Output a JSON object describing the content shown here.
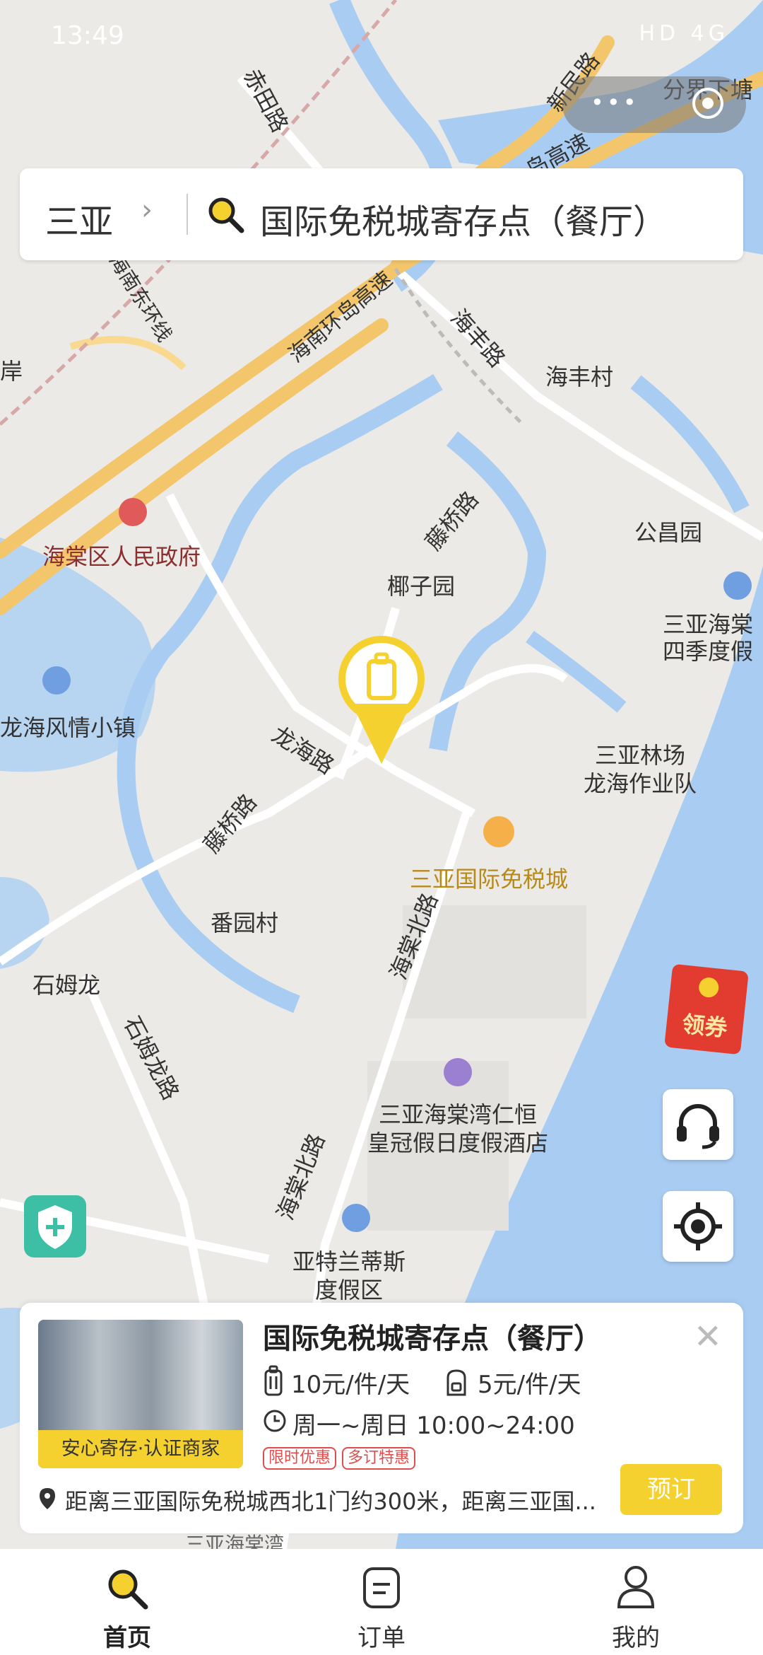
{
  "status_bar": {
    "time": "13:49",
    "indicators": "HD 4G"
  },
  "search": {
    "city": "三亚",
    "query": "国际免税城寄存点（餐厅）"
  },
  "map": {
    "labels": [
      {
        "name": "label-chitian-road",
        "text": "赤田路"
      },
      {
        "name": "label-xinmin-road",
        "text": "新民路"
      },
      {
        "name": "label-fenjiexiatang",
        "text": "分界下塘"
      },
      {
        "name": "label-expressway-top",
        "text": "岛高速"
      },
      {
        "name": "label-hainan-east-ring",
        "text": "海南东环线"
      },
      {
        "name": "label-hainan-ring-expressway",
        "text": "海南环岛高速"
      },
      {
        "name": "label-haifeng-road",
        "text": "海丰路"
      },
      {
        "name": "label-haifeng-village",
        "text": "海丰村"
      },
      {
        "name": "label-an",
        "text": "岸"
      },
      {
        "name": "label-gongchang-garden",
        "text": "公昌园"
      },
      {
        "name": "label-haitang-government",
        "text": "海棠区人民政府"
      },
      {
        "name": "label-tengqiao-road-north",
        "text": "藤桥路"
      },
      {
        "name": "label-yezi-garden",
        "text": "椰子园"
      },
      {
        "name": "label-four-seasons",
        "text": "三亚海棠\n四季度假"
      },
      {
        "name": "label-longhai-town",
        "text": "龙海风情小镇"
      },
      {
        "name": "label-longhai-road",
        "text": "龙海路"
      },
      {
        "name": "label-sanya-forest-team",
        "text": "三亚林场\n龙海作业队"
      },
      {
        "name": "label-tengqiao-road-south",
        "text": "藤桥路"
      },
      {
        "name": "label-duty-free-city",
        "text": "三亚国际免税城"
      },
      {
        "name": "label-fanyuan-village",
        "text": "番园村"
      },
      {
        "name": "label-haitang-north-road-1",
        "text": "海棠北路"
      },
      {
        "name": "label-shimulong",
        "text": "石姆龙"
      },
      {
        "name": "label-shimulong-road",
        "text": "石姆龙路"
      },
      {
        "name": "label-crowne-plaza",
        "text": "三亚海棠湾仁恒\n皇冠假日度假酒店"
      },
      {
        "name": "label-haitang-north-road-2",
        "text": "海棠北路"
      },
      {
        "name": "label-atlantis",
        "text": "亚特兰蒂斯\n度假区"
      },
      {
        "name": "label-bottom-partial",
        "text": "三亚海棠湾"
      }
    ],
    "coupon_label": "领券"
  },
  "card": {
    "name": "国际免税城寄存点（餐厅）",
    "photo_badge": "安心寄存·认证商家",
    "price_luggage": "10元/件/天",
    "price_bag": "5元/件/天",
    "hours": "周一~周日 10:00~24:00",
    "tags": [
      "限时优惠",
      "多订特惠"
    ],
    "address": "距离三亚国际免税城西北1门约300米，距离三亚国...",
    "book_label": "预订"
  },
  "tabs": [
    {
      "label": "首页",
      "icon": "search-icon"
    },
    {
      "label": "订单",
      "icon": "order-icon"
    },
    {
      "label": "我的",
      "icon": "user-icon"
    }
  ],
  "colors": {
    "accent": "#F5D130",
    "water": "#A9CDF2",
    "land": "#ECEAE6",
    "road_major": "#F3C66B"
  }
}
